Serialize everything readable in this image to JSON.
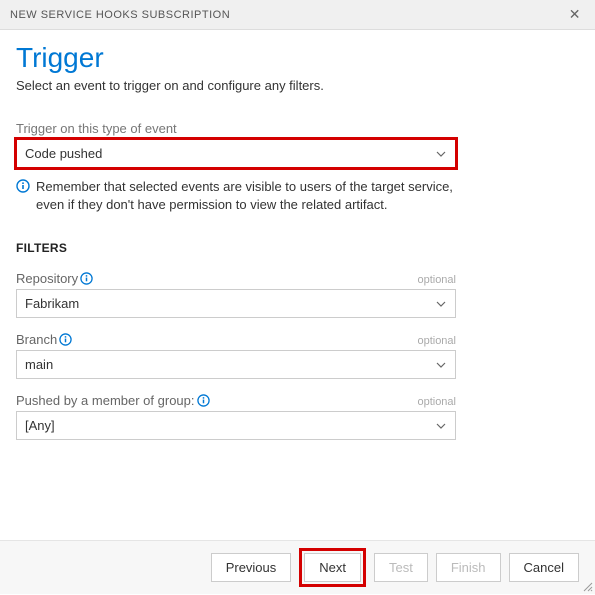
{
  "titlebar": {
    "title": "NEW SERVICE HOOKS SUBSCRIPTION"
  },
  "header": {
    "title": "Trigger",
    "subtitle": "Select an event to trigger on and configure any filters."
  },
  "event": {
    "label": "Trigger on this type of event",
    "value": "Code pushed",
    "info": "Remember that selected events are visible to users of the target service, even if they don't have permission to view the related artifact."
  },
  "filters": {
    "heading": "FILTERS",
    "optional_text": "optional",
    "repository": {
      "label": "Repository",
      "value": "Fabrikam"
    },
    "branch": {
      "label": "Branch",
      "value": "main"
    },
    "group": {
      "label": "Pushed by a member of group:",
      "value": "[Any]"
    }
  },
  "footer": {
    "previous": "Previous",
    "next": "Next",
    "test": "Test",
    "finish": "Finish",
    "cancel": "Cancel"
  }
}
